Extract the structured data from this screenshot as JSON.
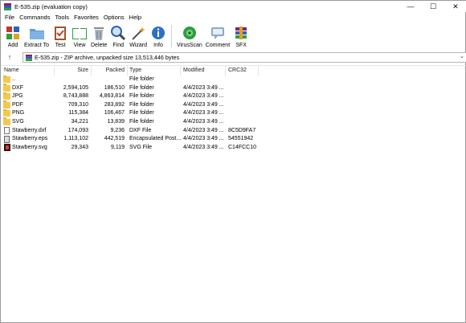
{
  "window": {
    "title": "E-535.zip (evaluation copy)",
    "controls": {
      "minimize": "—",
      "maximize": "☐",
      "close": "✕"
    }
  },
  "menu": [
    "File",
    "Commands",
    "Tools",
    "Favorites",
    "Options",
    "Help"
  ],
  "toolbar": [
    {
      "label": "Add",
      "icon": "add-archive-icon"
    },
    {
      "label": "Extract To",
      "icon": "extract-folder-icon"
    },
    {
      "label": "Test",
      "icon": "test-clipboard-icon"
    },
    {
      "label": "View",
      "icon": "view-book-icon"
    },
    {
      "label": "Delete",
      "icon": "trash-icon"
    },
    {
      "label": "Find",
      "icon": "magnifier-icon"
    },
    {
      "label": "Wizard",
      "icon": "wizard-wand-icon"
    },
    {
      "label": "Info",
      "icon": "info-icon"
    },
    {
      "label": "VirusScan",
      "icon": "virusscan-icon"
    },
    {
      "label": "Comment",
      "icon": "comment-icon"
    },
    {
      "label": "SFX",
      "icon": "sfx-icon"
    }
  ],
  "address": {
    "up": "↑",
    "path": "E-535.zip - ZIP archive, unpacked size 13,513,446 bytes",
    "dropdown": "⌄"
  },
  "columns": {
    "name": "Name",
    "size": "Size",
    "packed": "Packed",
    "type": "Type",
    "modified": "Modified",
    "crc": "CRC32"
  },
  "rows": [
    {
      "name": "..",
      "size": "",
      "packed": "",
      "type": "File folder",
      "modified": "",
      "crc": "",
      "icon": "folder"
    },
    {
      "name": "DXF",
      "size": "2,594,105",
      "packed": "186,510",
      "type": "File folder",
      "modified": "4/4/2023 3:49 ...",
      "crc": "",
      "icon": "folder"
    },
    {
      "name": "JPG",
      "size": "8,743,888",
      "packed": "4,863,814",
      "type": "File folder",
      "modified": "4/4/2023 3:49 ...",
      "crc": "",
      "icon": "folder"
    },
    {
      "name": "PDF",
      "size": "709,310",
      "packed": "283,892",
      "type": "File folder",
      "modified": "4/4/2023 3:49 ...",
      "crc": "",
      "icon": "folder"
    },
    {
      "name": "PNG",
      "size": "115,384",
      "packed": "106,467",
      "type": "File folder",
      "modified": "4/4/2023 3:49 ...",
      "crc": "",
      "icon": "folder"
    },
    {
      "name": "SVG",
      "size": "34,221",
      "packed": "13,839",
      "type": "File folder",
      "modified": "4/4/2023 3:49 ...",
      "crc": "",
      "icon": "folder"
    },
    {
      "name": "Stawberry.dxf",
      "size": "174,093",
      "packed": "9,236",
      "type": "DXF File",
      "modified": "4/4/2023 3:49 ...",
      "crc": "8C5D9FA7",
      "icon": "doc"
    },
    {
      "name": "Stawberry.eps",
      "size": "1,113,102",
      "packed": "442,519",
      "type": "Encapsulated Post...",
      "modified": "4/4/2023 3:49 ...",
      "crc": "54551942",
      "icon": "eps"
    },
    {
      "name": "Stawberry.svg",
      "size": "29,343",
      "packed": "9,119",
      "type": "SVG File",
      "modified": "4/4/2023 3:49 ...",
      "crc": "C14FCC10",
      "icon": "svg"
    }
  ],
  "colors": {
    "accent_green": "#2e9e3e",
    "folder": "#f2c94c",
    "info_blue": "#2f6fc4"
  }
}
